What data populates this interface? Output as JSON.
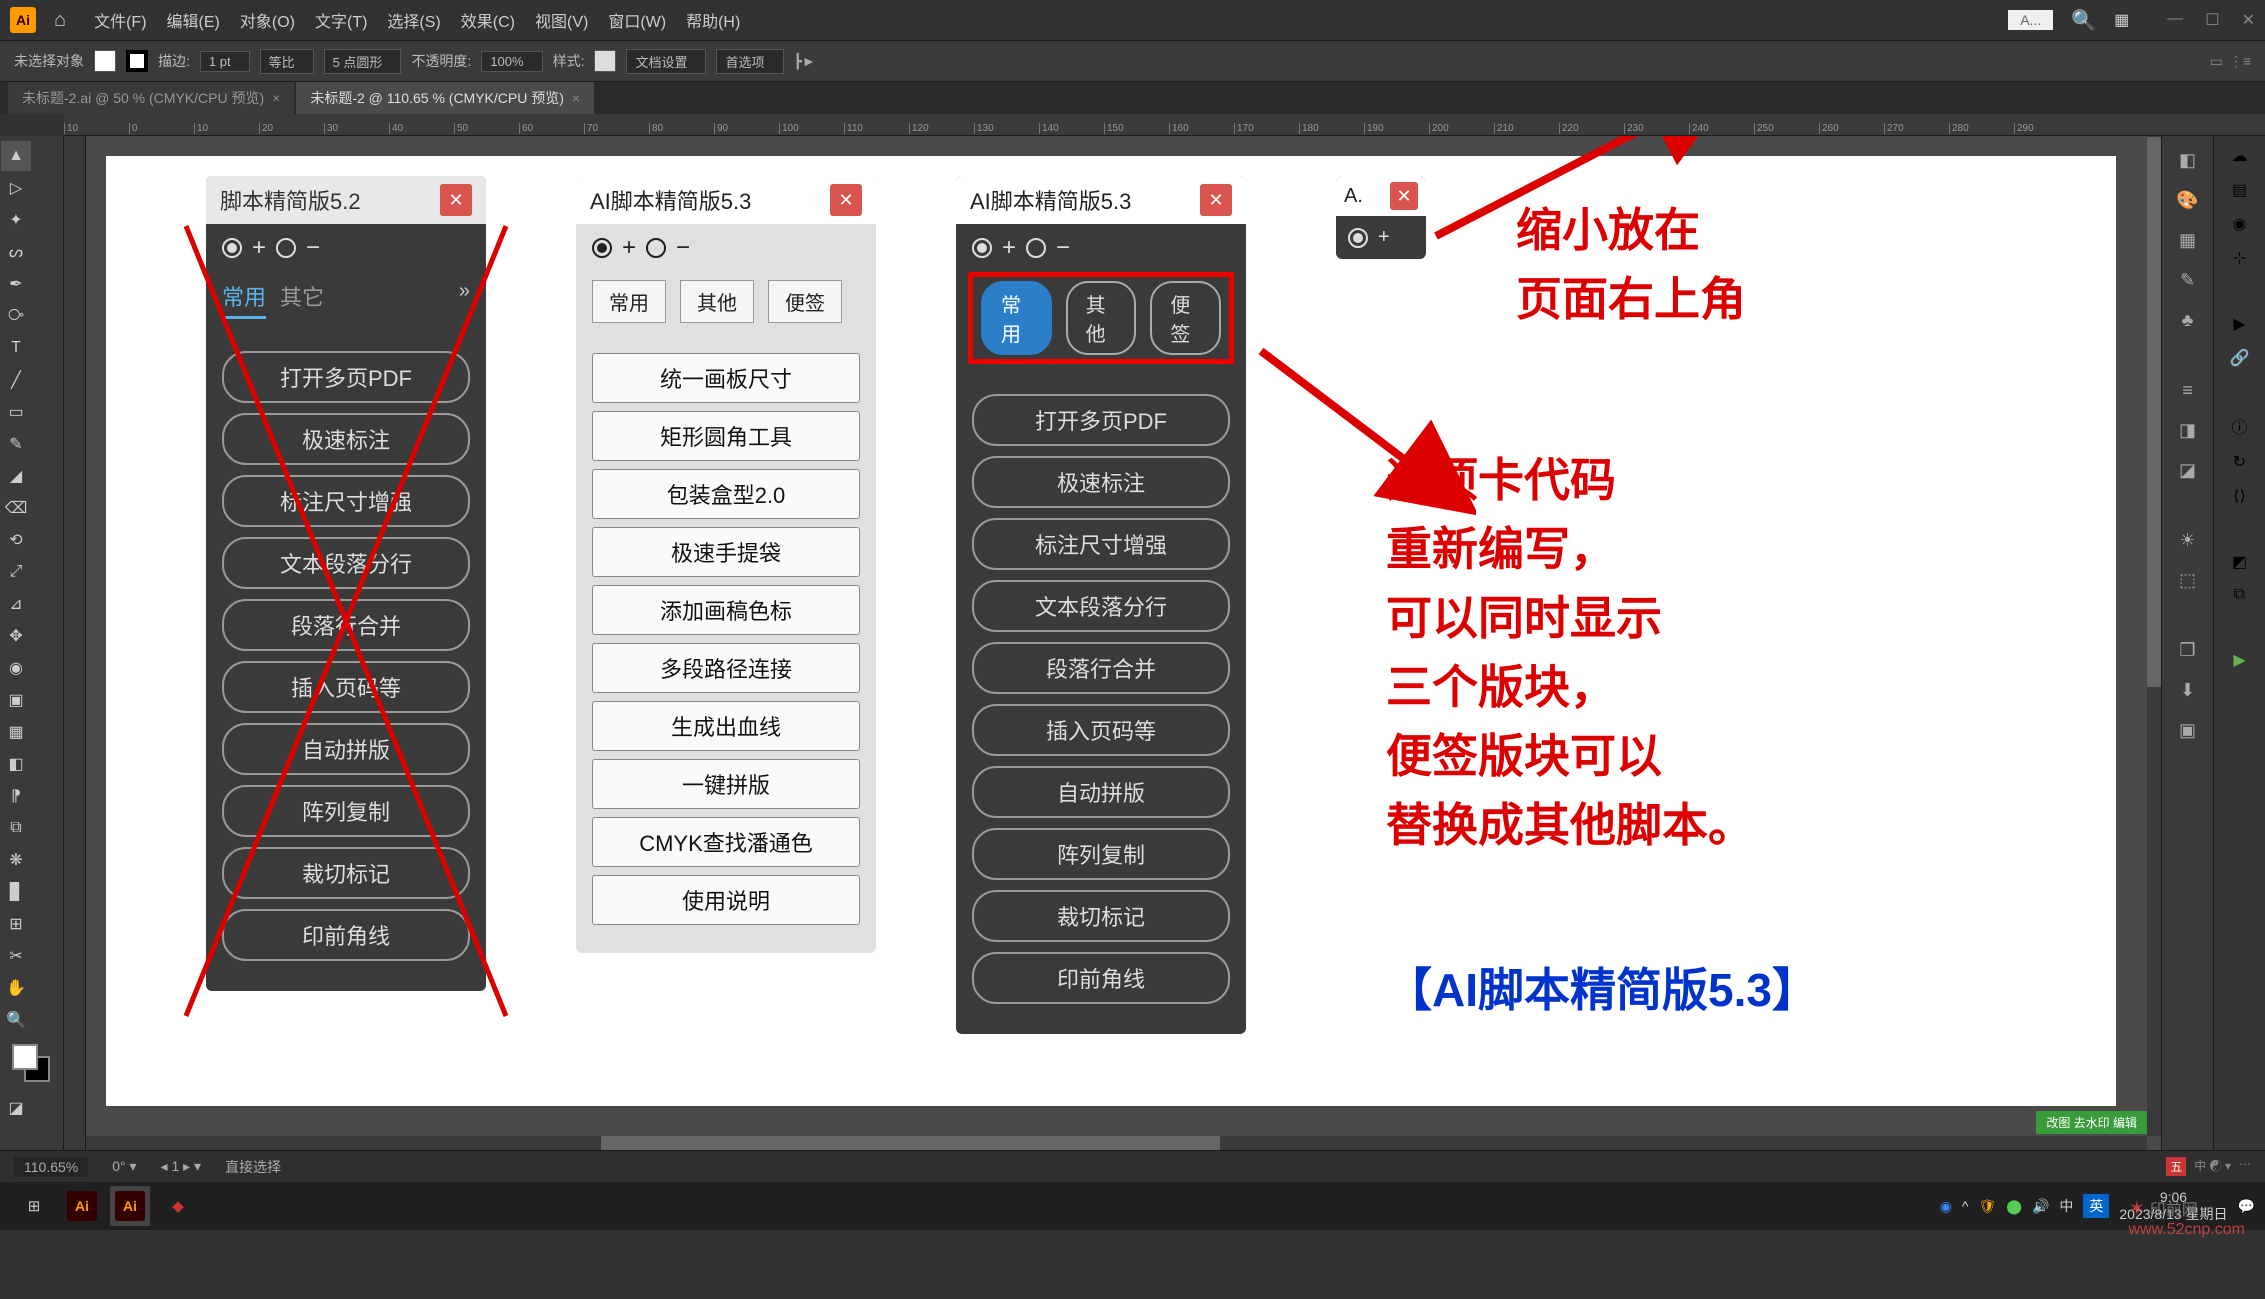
{
  "menubar": {
    "items": [
      "文件(F)",
      "编辑(E)",
      "对象(O)",
      "文字(T)",
      "选择(S)",
      "效果(C)",
      "视图(V)",
      "窗口(W)",
      "帮助(H)"
    ],
    "mini_input": "A..."
  },
  "optbar": {
    "no_selection": "未选择对象",
    "stroke_label": "描边:",
    "stroke_value": "1 pt",
    "uniform": "等比",
    "corner_label": "5 点圆形",
    "opacity_label": "不透明度:",
    "opacity_value": "100%",
    "style_label": "样式:",
    "doc_setup": "文档设置",
    "prefs": "首选项"
  },
  "tabs": [
    {
      "label": "未标题-2.ai @ 50 % (CMYK/CPU 预览)",
      "active": false
    },
    {
      "label": "未标题-2 @ 110.65 % (CMYK/CPU 预览)",
      "active": true
    }
  ],
  "ruler_start": -10,
  "panel1": {
    "title": "脚本精简版5.2",
    "tabs": [
      "常用",
      "其它"
    ],
    "buttons": [
      "打开多页PDF",
      "极速标注",
      "标注尺寸增强",
      "文本段落分行",
      "段落行合并",
      "插入页码等",
      "自动拼版",
      "阵列复制",
      "裁切标记",
      "印前角线"
    ]
  },
  "panel2": {
    "title": "AI脚本精简版5.3",
    "tabs": [
      "常用",
      "其他",
      "便签"
    ],
    "buttons": [
      "统一画板尺寸",
      "矩形圆角工具",
      "包装盒型2.0",
      "极速手提袋",
      "添加画稿色标",
      "多段路径连接",
      "生成出血线",
      "一键拼版",
      "CMYK查找潘通色",
      "使用说明"
    ]
  },
  "panel3": {
    "title": "AI脚本精简版5.3",
    "tabs": [
      "常用",
      "其他",
      "便签"
    ],
    "buttons": [
      "打开多页PDF",
      "极速标注",
      "标注尺寸增强",
      "文本段落分行",
      "段落行合并",
      "插入页码等",
      "自动拼版",
      "阵列复制",
      "裁切标记",
      "印前角线"
    ]
  },
  "panel4": {
    "title": "A."
  },
  "annotations": {
    "top": "缩小放在\n页面右上角",
    "mid": "选项卡代码\n重新编写，\n可以同时显示\n三个版块，\n便签版块可以\n替换成其他脚本。",
    "bottom": "【AI脚本精简版5.3】"
  },
  "statusbar": {
    "zoom": "110.65%",
    "tool": "直接选择"
  },
  "taskbar": {
    "time": "9:06",
    "date": "2023/8/13 星期日",
    "ime": "中"
  },
  "watermark": "www.52cnp.com"
}
